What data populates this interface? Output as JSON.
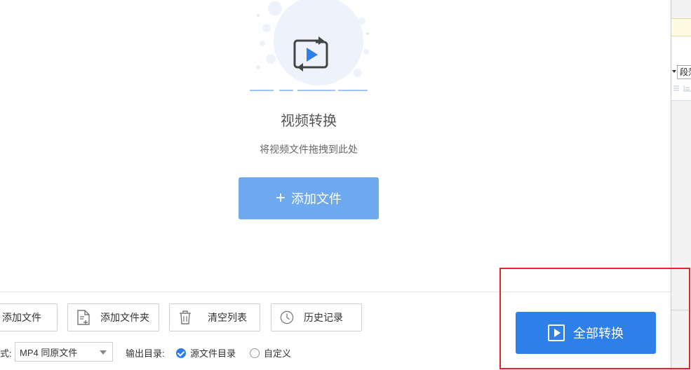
{
  "dropzone": {
    "title": "视频转换",
    "hint": "将视频文件拖拽到此处",
    "add_button_icon": "plus-icon",
    "add_button_label": "添加文件"
  },
  "toolbar": {
    "add_file": {
      "label": "添加文件",
      "icon": "add-file-icon"
    },
    "add_folder": {
      "label": "添加文件夹",
      "icon": "add-folder-icon"
    },
    "clear_list": {
      "label": "清空列表",
      "icon": "trash-icon"
    },
    "history": {
      "label": "历史记录",
      "icon": "clock-icon"
    }
  },
  "output": {
    "format_label": "式:",
    "format_value": "MP4 同原文件",
    "dir_label": "输出目录:",
    "dir_options": [
      {
        "label": "源文件目录",
        "selected": true
      },
      {
        "label": "自定义",
        "selected": false
      }
    ]
  },
  "convert_all": {
    "label": "全部转换",
    "icon": "play-square-icon"
  },
  "background_window": {
    "select_value": "段落"
  },
  "colors": {
    "primary": "#2e80e8",
    "primary_light": "#6ea9f0",
    "highlight": "#e8242a"
  }
}
